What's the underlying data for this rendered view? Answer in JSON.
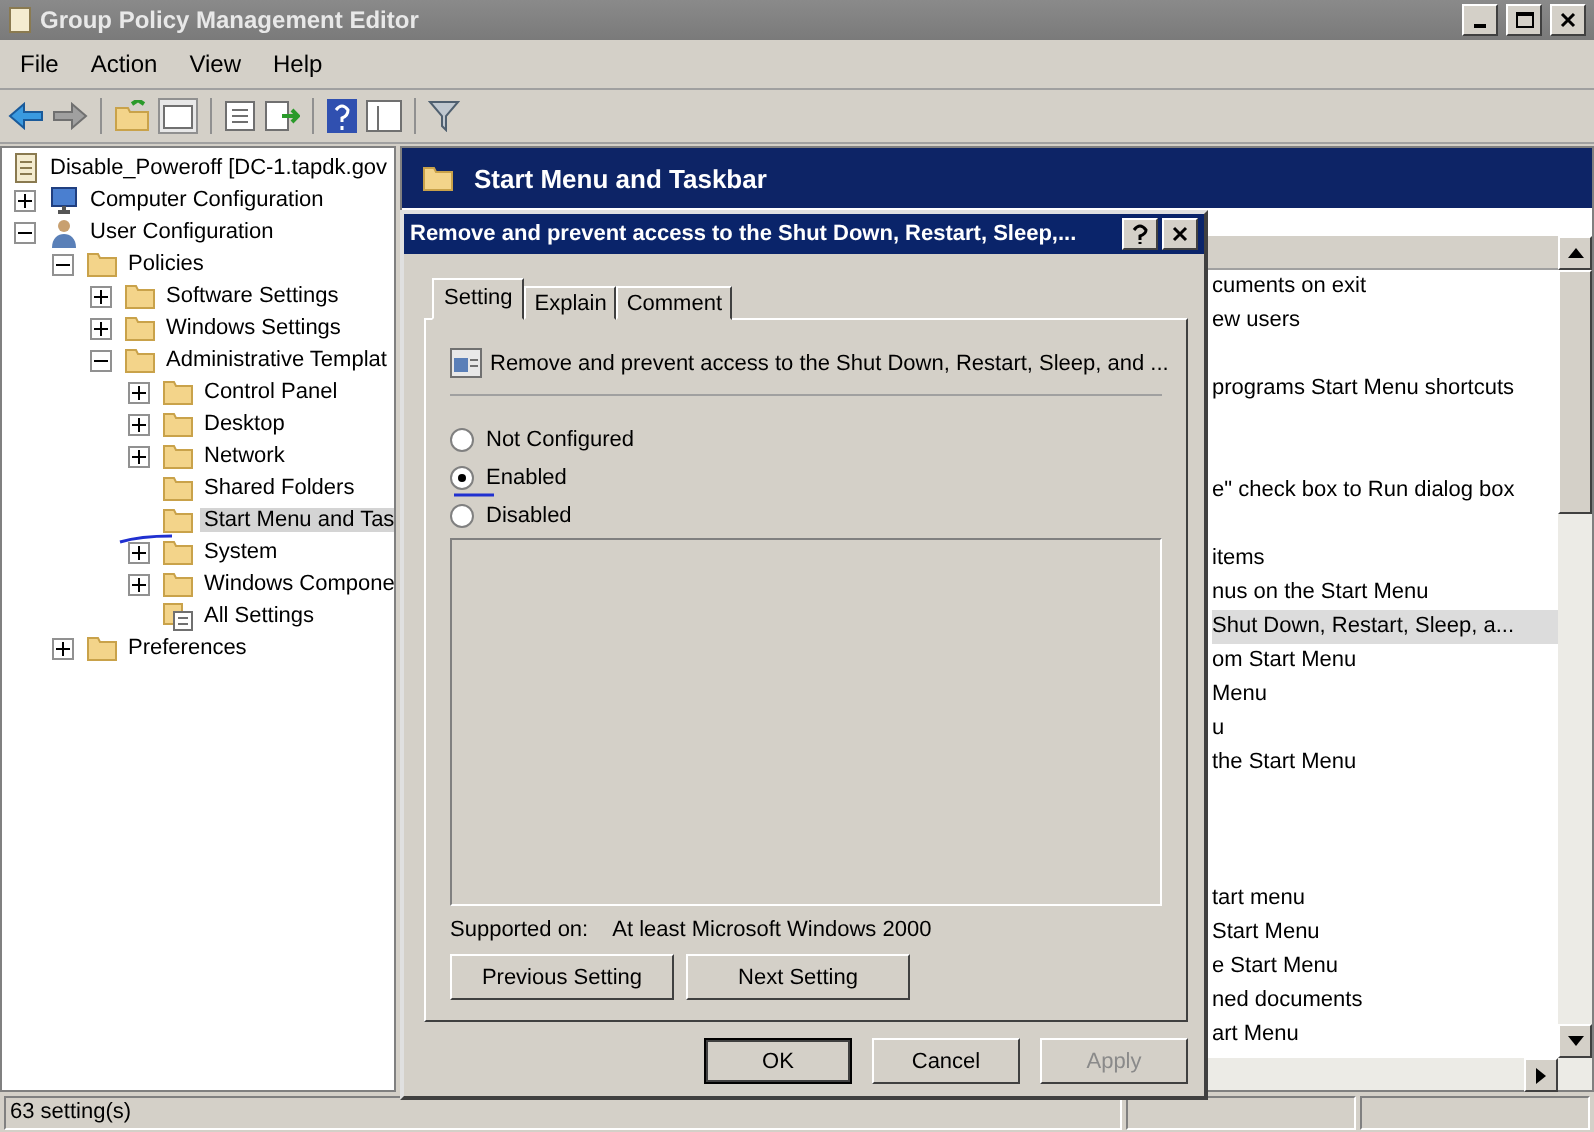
{
  "window": {
    "title": "Group Policy Management Editor"
  },
  "menu": [
    "File",
    "Action",
    "View",
    "Help"
  ],
  "tree": [
    {
      "label": "Disable_Poweroff [DC-1.tapdk.gov",
      "kind": "gpo",
      "selected": false,
      "children": [
        {
          "label": "Computer Configuration",
          "kind": "computer",
          "expanded": false,
          "selected": false
        },
        {
          "label": "User Configuration",
          "kind": "user",
          "expanded": true,
          "selected": false,
          "children": [
            {
              "label": "Policies",
              "kind": "folder",
              "expanded": true,
              "selected": false,
              "children": [
                {
                  "label": "Software Settings",
                  "kind": "folder",
                  "expanded": false,
                  "selected": false
                },
                {
                  "label": "Windows Settings",
                  "kind": "folder",
                  "expanded": false,
                  "selected": false
                },
                {
                  "label": "Administrative Templat",
                  "kind": "folder",
                  "expanded": true,
                  "selected": false,
                  "children": [
                    {
                      "label": "Control Panel",
                      "kind": "folder",
                      "expanded": false,
                      "selected": false
                    },
                    {
                      "label": "Desktop",
                      "kind": "folder",
                      "expanded": false,
                      "selected": false
                    },
                    {
                      "label": "Network",
                      "kind": "folder",
                      "expanded": false,
                      "selected": false
                    },
                    {
                      "label": "Shared Folders",
                      "kind": "folder",
                      "selected": false
                    },
                    {
                      "label": "Start Menu and Tas",
                      "kind": "folder",
                      "selected": true
                    },
                    {
                      "label": "System",
                      "kind": "folder",
                      "expanded": false,
                      "selected": false
                    },
                    {
                      "label": "Windows Compone",
                      "kind": "folder",
                      "expanded": false,
                      "selected": false
                    },
                    {
                      "label": "All Settings",
                      "kind": "settings",
                      "selected": false
                    }
                  ]
                }
              ]
            },
            {
              "label": "Preferences",
              "kind": "folder",
              "expanded": false,
              "selected": false
            }
          ]
        }
      ]
    }
  ],
  "pane": {
    "title": "Start Menu and Taskbar",
    "rows": [
      {
        "kind": "setting",
        "text": "cuments on exit",
        "selected": false
      },
      {
        "kind": "setting",
        "text": "ew users",
        "selected": false
      },
      {
        "kind": "blank"
      },
      {
        "kind": "setting",
        "text": "programs Start Menu shortcuts",
        "selected": false
      },
      {
        "kind": "blank"
      },
      {
        "kind": "blank"
      },
      {
        "kind": "setting",
        "text": "e\" check box to Run dialog box",
        "selected": false
      },
      {
        "kind": "blank"
      },
      {
        "kind": "setting",
        "text": "items",
        "selected": false
      },
      {
        "kind": "setting",
        "text": "nus on the Start Menu",
        "selected": false
      },
      {
        "kind": "setting",
        "text": "Shut Down, Restart, Sleep, a...",
        "selected": true
      },
      {
        "kind": "setting",
        "text": "om Start Menu",
        "selected": false
      },
      {
        "kind": "setting",
        "text": "Menu",
        "selected": false
      },
      {
        "kind": "setting",
        "text": "u",
        "selected": false
      },
      {
        "kind": "setting",
        "text": "the Start Menu",
        "selected": false
      },
      {
        "kind": "blank"
      },
      {
        "kind": "blank"
      },
      {
        "kind": "blank"
      },
      {
        "kind": "setting",
        "text": "tart menu",
        "selected": false
      },
      {
        "kind": "setting",
        "text": "Start Menu",
        "selected": false
      },
      {
        "kind": "setting",
        "text": "e Start Menu",
        "selected": false
      },
      {
        "kind": "setting",
        "text": "ned documents",
        "selected": false
      },
      {
        "kind": "setting",
        "text": "art Menu",
        "selected": false
      }
    ]
  },
  "dialog": {
    "title": "Remove and prevent access to the Shut Down, Restart, Sleep,...",
    "tabs": [
      {
        "label": "Setting",
        "selected": true
      },
      {
        "label": "Explain",
        "selected": false
      },
      {
        "label": "Comment",
        "selected": false
      }
    ],
    "policy_name": "Remove and prevent access to the Shut Down, Restart, Sleep, and ...",
    "options": [
      {
        "label": "Not Configured",
        "selected": false
      },
      {
        "label": "Enabled",
        "selected": true
      },
      {
        "label": "Disabled",
        "selected": false
      }
    ],
    "supported_label": "Supported on:",
    "supported_value": "At least Microsoft Windows 2000",
    "nav_buttons": [
      "Previous Setting",
      "Next Setting"
    ],
    "buttons": [
      {
        "label": "OK",
        "default": true,
        "disabled": false
      },
      {
        "label": "Cancel",
        "default": false,
        "disabled": false
      },
      {
        "label": "Apply",
        "default": false,
        "disabled": true
      }
    ]
  },
  "status_bar": {
    "text": "63 setting(s)"
  }
}
